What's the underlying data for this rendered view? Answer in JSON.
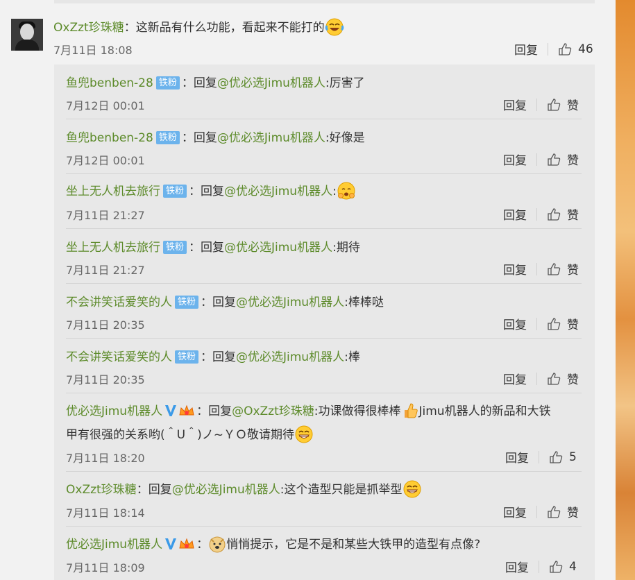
{
  "colors": {
    "username": "#5d8b2b",
    "badge": "#6cb3ec",
    "background": "#f2f2f2",
    "reply_bg": "#e8e8e8"
  },
  "main_comment": {
    "user": "OxZzt珍珠糖",
    "text": "这新品有什么功能，看起来不能打的",
    "emoji": "laugh-cry-emoji",
    "time": "7月11日 18:08",
    "reply_label": "回复",
    "likes": "46"
  },
  "replies": [
    {
      "user": "鱼兜benben-28",
      "badge": "铁粉",
      "reply_prefix": "回复",
      "at": "@优必选Jimu机器人",
      "text": ":厉害了",
      "time": "7月12日 00:01",
      "reply_label": "回复",
      "like_label": "赞"
    },
    {
      "user": "鱼兜benben-28",
      "badge": "铁粉",
      "reply_prefix": "回复",
      "at": "@优必选Jimu机器人",
      "text": ":好像是",
      "time": "7月12日 00:01",
      "reply_label": "回复",
      "like_label": "赞"
    },
    {
      "user": "坐上无人机去旅行",
      "badge": "铁粉",
      "reply_prefix": "回复",
      "at": "@优必选Jimu机器人",
      "text": ":",
      "emoji": "shy-emoji",
      "time": "7月11日 21:27",
      "reply_label": "回复",
      "like_label": "赞"
    },
    {
      "user": "坐上无人机去旅行",
      "badge": "铁粉",
      "reply_prefix": "回复",
      "at": "@优必选Jimu机器人",
      "text": ":期待",
      "time": "7月11日 21:27",
      "reply_label": "回复",
      "like_label": "赞"
    },
    {
      "user": "不会讲笑话爱笑的人",
      "badge": "铁粉",
      "reply_prefix": "回复",
      "at": "@优必选Jimu机器人",
      "text": ":棒棒哒",
      "time": "7月11日 20:35",
      "reply_label": "回复",
      "like_label": "赞"
    },
    {
      "user": "不会讲笑话爱笑的人",
      "badge": "铁粉",
      "reply_prefix": "回复",
      "at": "@优必选Jimu机器人",
      "text": ":棒",
      "time": "7月11日 20:35",
      "reply_label": "回复",
      "like_label": "赞"
    },
    {
      "user": "优必选Jimu机器人",
      "reply_prefix": "回复",
      "at": "@OxZzt珍珠糖",
      "text": ":功课做得很棒棒",
      "text2": "Jimu机器人的新品和大铁",
      "line2": "甲有很强的关系哟(＾U＾)ノ~ＹＯ敬请期待",
      "time": "7月11日 18:20",
      "reply_label": "回复",
      "likes": "5"
    },
    {
      "user": "OxZzt珍珠糖",
      "reply_prefix": "回复",
      "at": "@优必选Jimu机器人",
      "text": ":这个造型只能是抓举型",
      "time": "7月11日 18:14",
      "reply_label": "回复",
      "like_label": "赞"
    },
    {
      "user": "优必选Jimu机器人",
      "text": "悄悄提示，它是不是和某些大铁甲的造型有点像?",
      "time": "7月11日 18:09",
      "reply_label": "回复",
      "likes": "4"
    }
  ]
}
